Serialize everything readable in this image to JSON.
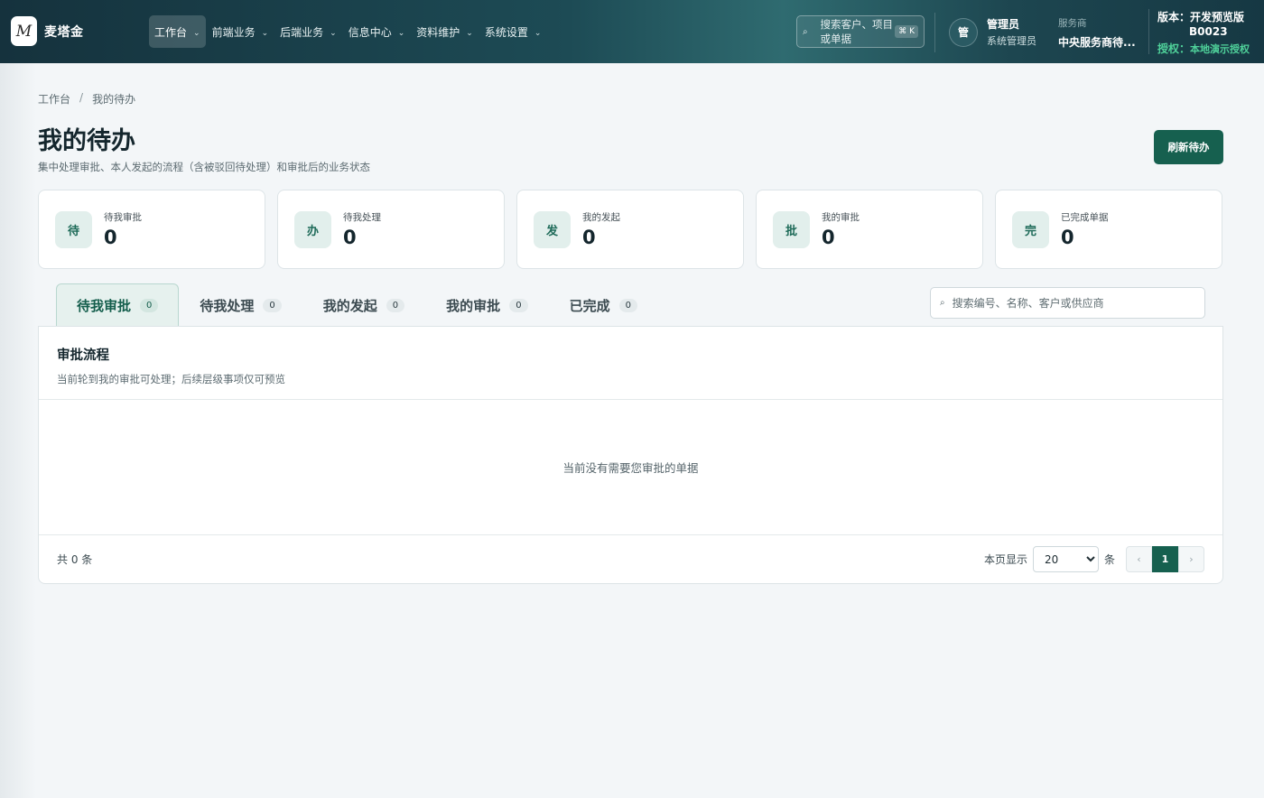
{
  "topbar": {
    "brand": {
      "logo_glyph": "M",
      "name": "麦塔金"
    },
    "nav": [
      {
        "label": "工作台",
        "active": true
      },
      {
        "label": "前端业务",
        "active": false
      },
      {
        "label": "后端业务",
        "active": false
      },
      {
        "label": "信息中心",
        "active": false
      },
      {
        "label": "资料维护",
        "active": false
      },
      {
        "label": "系统设置",
        "active": false
      }
    ],
    "search": {
      "icon": "search-icon",
      "text": "搜索客户、项目或单据",
      "shortcut": "⌘ K"
    },
    "user": {
      "avatar": "管",
      "name": "管理员",
      "role": "系统管理员"
    },
    "provider": {
      "label": "服务商",
      "name": "中央服务商待..."
    },
    "version": {
      "label": "版本：",
      "value": "开发预览版",
      "build": "B0023",
      "license_label": "授权：",
      "license_value": "本地演示授权"
    }
  },
  "breadcrumb": {
    "home": "工作台",
    "separator": "/",
    "current": "我的待办"
  },
  "page": {
    "title": "我的待办",
    "description": "集中处理审批、本人发起的流程（含被驳回待处理）和审批后的业务状态",
    "refresh_button": "刷新待办"
  },
  "stats": [
    {
      "icon": "待",
      "label": "待我审批",
      "value": "0"
    },
    {
      "icon": "办",
      "label": "待我处理",
      "value": "0"
    },
    {
      "icon": "发",
      "label": "我的发起",
      "value": "0"
    },
    {
      "icon": "批",
      "label": "我的审批",
      "value": "0"
    },
    {
      "icon": "完",
      "label": "已完成单据",
      "value": "0"
    }
  ],
  "tabs": [
    {
      "label": "待我审批",
      "count": "0",
      "active": true
    },
    {
      "label": "待我处理",
      "count": "0",
      "active": false
    },
    {
      "label": "我的发起",
      "count": "0",
      "active": false
    },
    {
      "label": "我的审批",
      "count": "0",
      "active": false
    },
    {
      "label": "已完成",
      "count": "0",
      "active": false
    }
  ],
  "list_search": {
    "icon": "search-icon",
    "placeholder": "搜索编号、名称、客户或供应商"
  },
  "panel": {
    "title": "审批流程",
    "subtitle": "当前轮到我的审批可处理；后续层级事项仅可预览",
    "empty_text": "当前没有需要您审批的单据"
  },
  "footer": {
    "total": "共 0 条",
    "per_page_label": "本页显示",
    "page_size": "20",
    "page_size_options": [
      "20"
    ],
    "unit": "条",
    "prev": "‹",
    "current_page": "1",
    "next": "›"
  },
  "colors": {
    "accent": "#16604f",
    "topbar": "#1d4b55",
    "license_green": "#4fd19a"
  }
}
